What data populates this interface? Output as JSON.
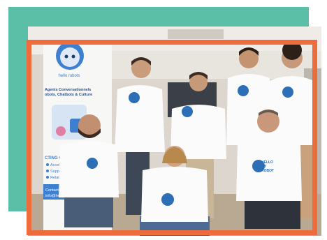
{
  "banner": {
    "brand": "hello robots",
    "line1": "Agents Conversationnels",
    "line2": "obots, Chatbots & Culture",
    "section": "CTING C",
    "items": [
      "Accel",
      "Suppo",
      "Relatio"
    ],
    "contact_line1": "Contact",
    "contact_line2": "info@he"
  },
  "shirt_text": {
    "line1": "HELLO",
    "line2": "MY",
    "line3": "ROBOT"
  },
  "colors": {
    "teal_block": "#5bbfa7",
    "orange_frame": "#ee6b3b",
    "shirt_logo_blue": "#2c6fb7"
  }
}
